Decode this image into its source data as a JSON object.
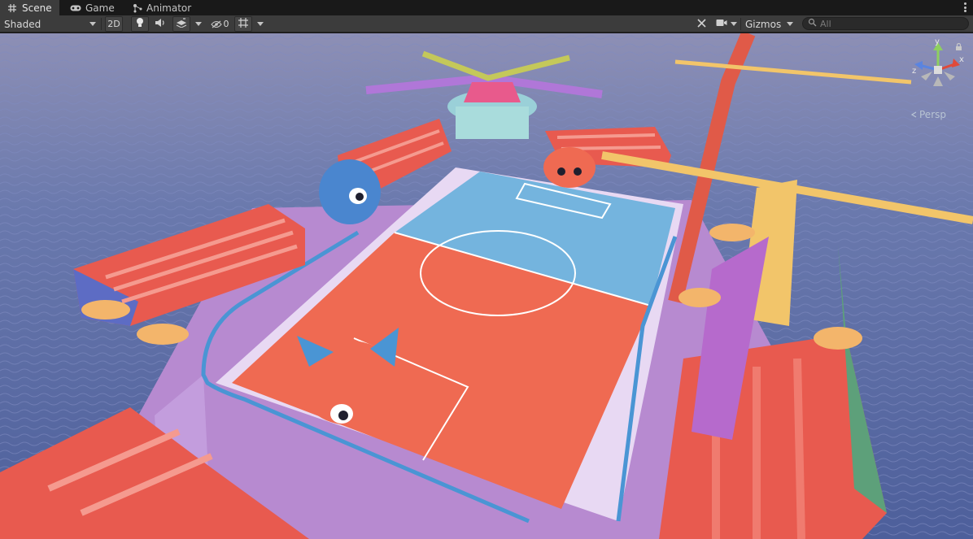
{
  "tabs": [
    {
      "label": "Scene",
      "icon": "grid-hash-icon",
      "active": true
    },
    {
      "label": "Game",
      "icon": "gamepad-icon",
      "active": false
    },
    {
      "label": "Animator",
      "icon": "animator-node-icon",
      "active": false
    }
  ],
  "toolbar": {
    "draw_mode": "Shaded",
    "mode_2d": "2D",
    "hidden_count": "0",
    "gizmos_label": "Gizmos",
    "search_placeholder": "All"
  },
  "scene_gizmo": {
    "y_label": "y",
    "x_label": "x",
    "z_label": "z",
    "projection": "Persp"
  },
  "colors": {
    "tab_active": "#3c3c3c",
    "toolbar_bg": "#3c3c3c",
    "panel_bg": "#191919",
    "court_red": "#ef6a52",
    "court_blue": "#74b4de",
    "water": "#5d6fa8",
    "bleacher_red": "#e85a4f",
    "platform_purple": "#b78ad0"
  }
}
